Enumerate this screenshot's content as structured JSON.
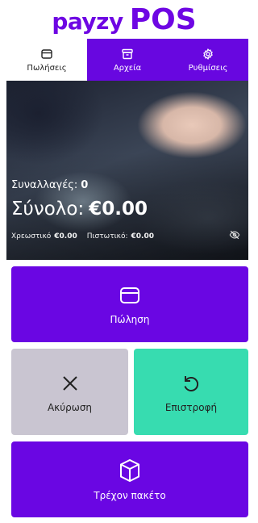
{
  "header": {
    "logo_part1": "payzy",
    "logo_part2": "POS"
  },
  "tabs": [
    {
      "label": "Πωλήσεις",
      "icon": "card-icon",
      "active": true
    },
    {
      "label": "Αρχεία",
      "icon": "archive-icon",
      "active": false
    },
    {
      "label": "Ρυθμίσεις",
      "icon": "gear-icon",
      "active": false
    }
  ],
  "summary": {
    "transactions_label": "Συναλλαγές:",
    "transactions_value": "0",
    "total_label": "Σύνολο:",
    "total_value": "€0.00",
    "debit_label": "Χρεωστικό",
    "debit_value": "€0.00",
    "credit_label": "Πιστωτικό:",
    "credit_value": "€0.00",
    "hide_icon": "eye-off-icon"
  },
  "actions": {
    "sale_label": "Πώληση",
    "cancel_label": "Ακύρωση",
    "refund_label": "Επιστροφή",
    "current_batch_label": "Τρέχον πακέτο"
  },
  "colors": {
    "brand": "#6a06e3",
    "teal": "#37dcb0",
    "gray": "#c9c5d1"
  }
}
